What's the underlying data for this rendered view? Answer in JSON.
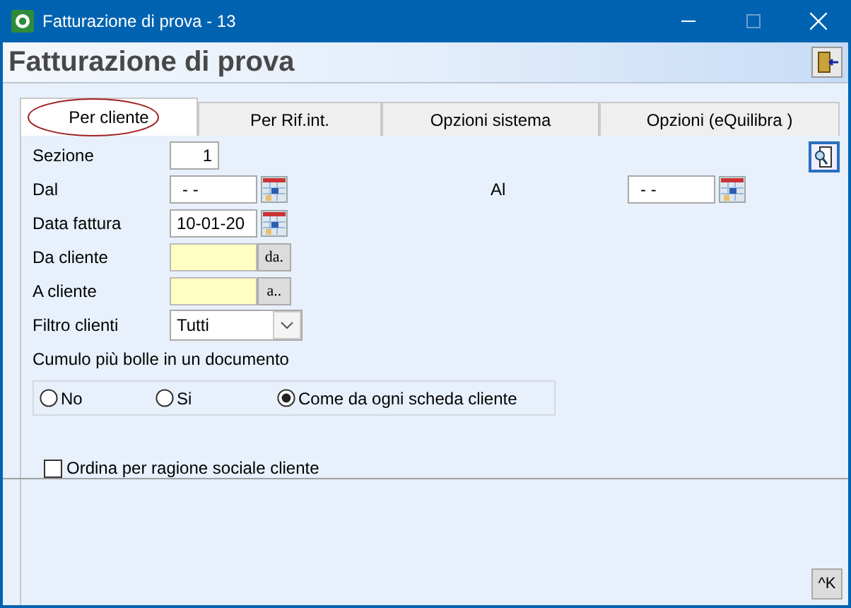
{
  "window": {
    "title": "Fatturazione di prova - 13"
  },
  "header": {
    "title": "Fatturazione di prova"
  },
  "tabs": [
    {
      "label": "Per cliente",
      "selected": true,
      "circled": true
    },
    {
      "label": "Per Rif.int.",
      "selected": false,
      "circled": false
    },
    {
      "label": "Opzioni sistema",
      "selected": false,
      "circled": false
    },
    {
      "label": "Opzioni (eQuilibra )",
      "selected": false,
      "circled": false
    }
  ],
  "form": {
    "sezione": {
      "label": "Sezione",
      "value": "1"
    },
    "dal": {
      "label": "Dal",
      "value": "- -"
    },
    "al": {
      "label": "Al",
      "value": "- -"
    },
    "data_fattura": {
      "label": "Data fattura",
      "value": "10-01-20"
    },
    "da_cliente": {
      "label": "Da cliente",
      "button": "da."
    },
    "a_cliente": {
      "label": "A cliente",
      "button": "a.."
    },
    "filtro_clienti": {
      "label": "Filtro clienti",
      "value": "Tutti"
    },
    "cumulo": {
      "label": "Cumulo più bolle in un documento",
      "options": [
        {
          "label": "No",
          "selected": false
        },
        {
          "label": "Si",
          "selected": false
        },
        {
          "label": "Come da ogni scheda cliente",
          "selected": true
        }
      ]
    },
    "ordina": {
      "label": "Ordina per ragione sociale cliente",
      "checked": false
    }
  },
  "footer": {
    "button": "^K"
  }
}
